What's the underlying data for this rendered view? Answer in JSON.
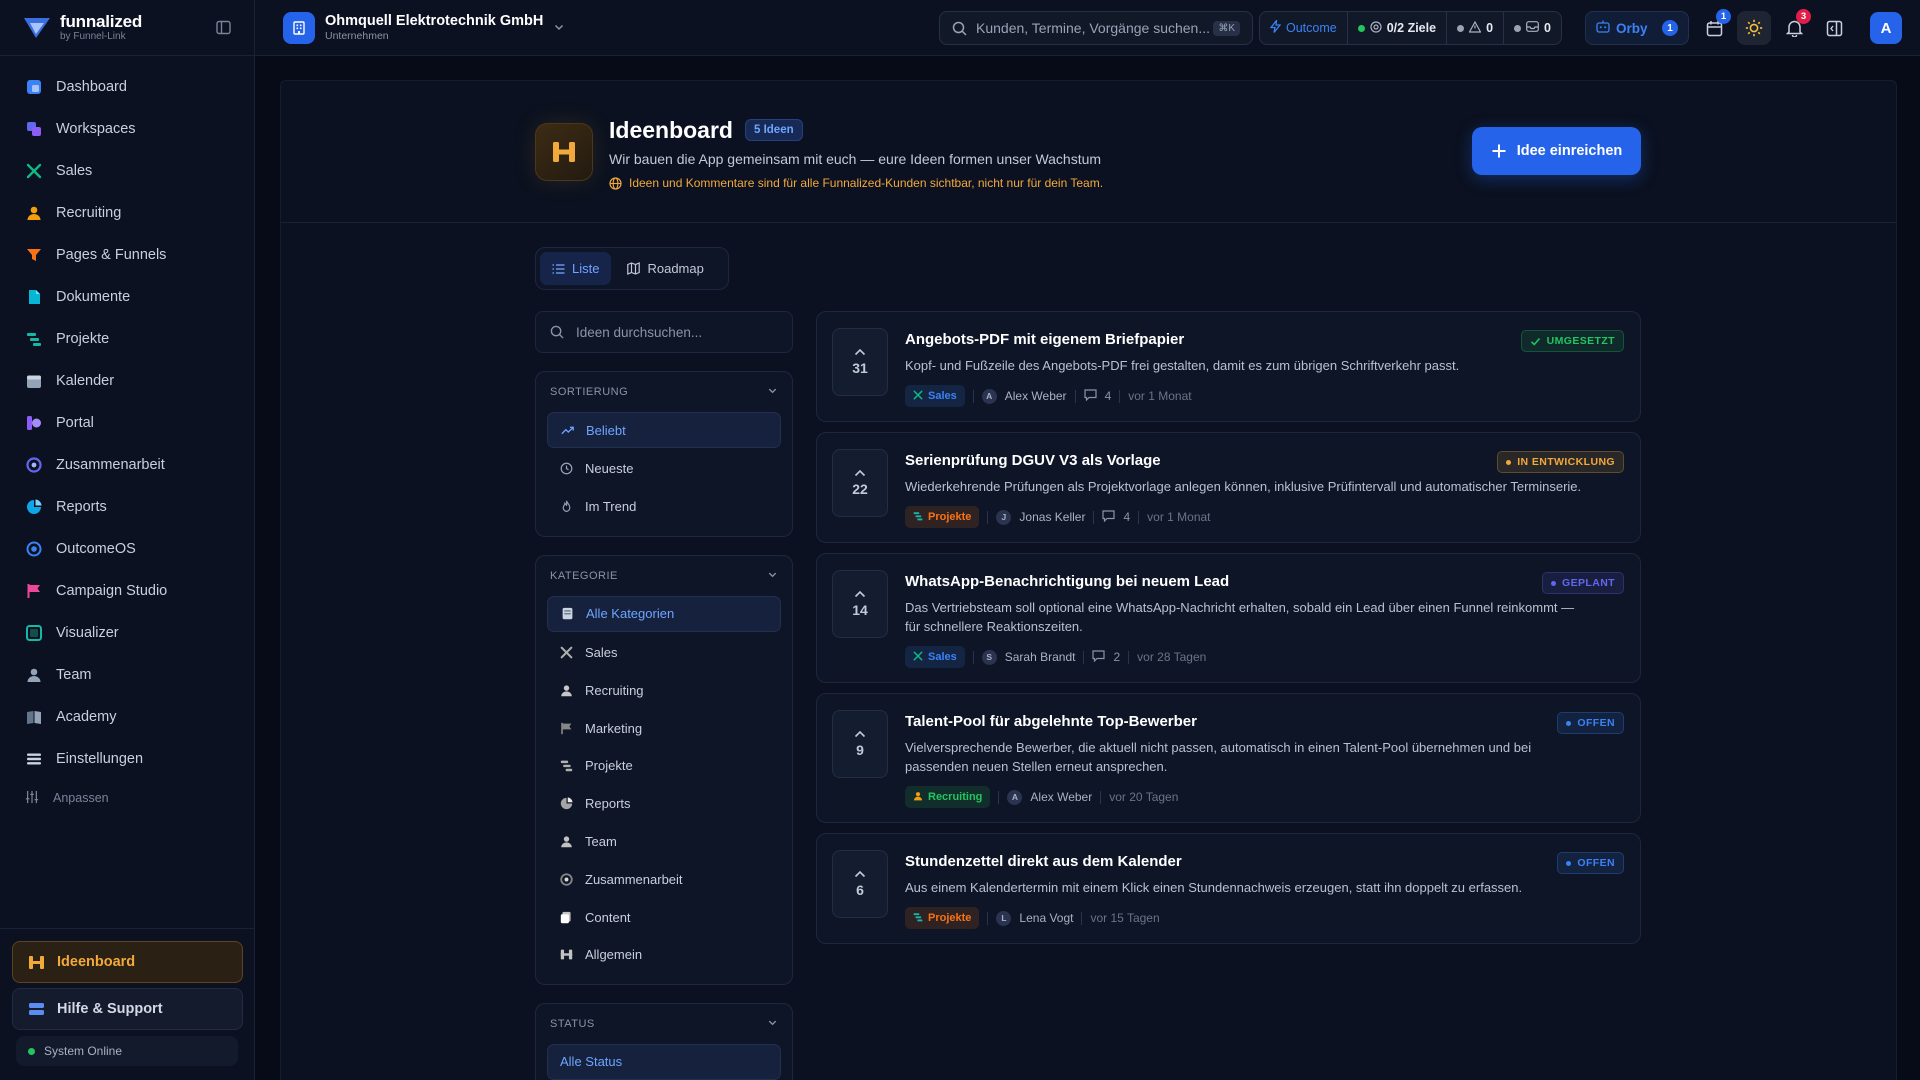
{
  "brand": {
    "name": "funnalized",
    "sub": "by Funnel-Link"
  },
  "colors": {
    "accent": "#2563eb",
    "warning": "#f2a93b",
    "success": "#22c55e",
    "bg": "#070b18"
  },
  "sidebar": {
    "items": [
      {
        "label": "Dashboard",
        "icon": "dashboard-icon"
      },
      {
        "label": "Workspaces",
        "icon": "workspaces-icon"
      },
      {
        "label": "Sales",
        "icon": "sales-icon"
      },
      {
        "label": "Recruiting",
        "icon": "recruiting-icon"
      },
      {
        "label": "Pages & Funnels",
        "icon": "funnel-icon"
      },
      {
        "label": "Dokumente",
        "icon": "document-icon"
      },
      {
        "label": "Projekte",
        "icon": "projects-icon"
      },
      {
        "label": "Kalender",
        "icon": "calendar-icon"
      },
      {
        "label": "Portal",
        "icon": "portal-icon"
      },
      {
        "label": "Zusammenarbeit",
        "icon": "collaboration-icon"
      },
      {
        "label": "Reports",
        "icon": "reports-icon"
      },
      {
        "label": "OutcomeOS",
        "icon": "outcome-icon"
      },
      {
        "label": "Campaign Studio",
        "icon": "flag-icon"
      },
      {
        "label": "Visualizer",
        "icon": "visualizer-icon"
      },
      {
        "label": "Team",
        "icon": "team-icon"
      },
      {
        "label": "Academy",
        "icon": "academy-icon"
      },
      {
        "label": "Einstellungen",
        "icon": "settings-icon"
      }
    ],
    "customize_label": "Anpassen",
    "ideenboard_label": "Ideenboard",
    "help_label": "Hilfe & Support",
    "system_status": "System Online"
  },
  "topbar": {
    "company_name": "Ohmquell Elektrotechnik GmbH",
    "company_sub": "Unternehmen",
    "search_placeholder": "Kunden, Termine, Vorgänge suchen...",
    "search_shortcut": "⌘K",
    "outcome_label": "Outcome",
    "goals_label": "0/2 Ziele",
    "warnings_count": "0",
    "messages_count": "0",
    "orby_label": "Orby",
    "orby_count": "1",
    "calendar_badge": "1",
    "notifications_badge": "3",
    "avatar_initial": "A"
  },
  "hero": {
    "title": "Ideenboard",
    "count_badge": "5 Ideen",
    "subtitle": "Wir bauen die App gemeinsam mit euch — eure Ideen formen unser Wachstum",
    "note": "Ideen und Kommentare sind für alle Funnalized-Kunden sichtbar, nicht nur für dein Team.",
    "submit_label": "Idee einreichen"
  },
  "view_toggle": {
    "list_label": "Liste",
    "roadmap_label": "Roadmap"
  },
  "filters": {
    "search_placeholder": "Ideen durchsuchen...",
    "sort": {
      "heading": "SORTIERUNG",
      "options": [
        {
          "label": "Beliebt",
          "icon": "trending-icon"
        },
        {
          "label": "Neueste",
          "icon": "clock-icon"
        },
        {
          "label": "Im Trend",
          "icon": "flame-icon"
        }
      ]
    },
    "category": {
      "heading": "KATEGORIE",
      "options": [
        {
          "label": "Alle Kategorien",
          "icon": "all-categories-icon"
        },
        {
          "label": "Sales",
          "icon": "sales-icon"
        },
        {
          "label": "Recruiting",
          "icon": "recruiting-icon"
        },
        {
          "label": "Marketing",
          "icon": "flag-icon"
        },
        {
          "label": "Projekte",
          "icon": "projects-icon"
        },
        {
          "label": "Reports",
          "icon": "reports-icon"
        },
        {
          "label": "Team",
          "icon": "team-icon"
        },
        {
          "label": "Zusammenarbeit",
          "icon": "collaboration-icon"
        },
        {
          "label": "Content",
          "icon": "content-icon"
        },
        {
          "label": "Allgemein",
          "icon": "general-icon"
        }
      ]
    },
    "status": {
      "heading": "STATUS",
      "options": [
        {
          "label": "Alle Status"
        }
      ]
    }
  },
  "ideas": [
    {
      "votes": "31",
      "title": "Angebots-PDF mit eigenem Briefpapier",
      "description": "Kopf- und Fußzeile des Angebots-PDF frei gestalten, damit es zum übrigen Schriftverkehr passt.",
      "category": "Sales",
      "category_color": "#3b82f6",
      "author_initial": "A",
      "author": "Alex Weber",
      "comments": "4",
      "time": "vor 1 Monat",
      "status": "UMGESETZT",
      "status_color": "#22c55e"
    },
    {
      "votes": "22",
      "title": "Serienprüfung DGUV V3 als Vorlage",
      "description": "Wiederkehrende Prüfungen als Projektvorlage anlegen können, inklusive Prüfintervall und automatischer Terminserie.",
      "category": "Projekte",
      "category_color": "#f97316",
      "author_initial": "J",
      "author": "Jonas Keller",
      "comments": "4",
      "time": "vor 1 Monat",
      "status": "IN ENTWICKLUNG",
      "status_color": "#f2a93b"
    },
    {
      "votes": "14",
      "title": "WhatsApp-Benachrichtigung bei neuem Lead",
      "description": "Das Vertriebsteam soll optional eine WhatsApp-Nachricht erhalten, sobald ein Lead über einen Funnel reinkommt — für schnellere Reaktionszeiten.",
      "category": "Sales",
      "category_color": "#3b82f6",
      "author_initial": "S",
      "author": "Sarah Brandt",
      "comments": "2",
      "time": "vor 28 Tagen",
      "status": "GEPLANT",
      "status_color": "#6366f1"
    },
    {
      "votes": "9",
      "title": "Talent-Pool für abgelehnte Top-Bewerber",
      "description": "Vielversprechende Bewerber, die aktuell nicht passen, automatisch in einen Talent-Pool übernehmen und bei passenden neuen Stellen erneut ansprechen.",
      "category": "Recruiting",
      "category_color": "#22c55e",
      "author_initial": "A",
      "author": "Alex Weber",
      "comments": "",
      "time": "vor 20 Tagen",
      "status": "OFFEN",
      "status_color": "#3b82f6"
    },
    {
      "votes": "6",
      "title": "Stundenzettel direkt aus dem Kalender",
      "description": "Aus einem Kalendertermin mit einem Klick einen Stundennachweis erzeugen, statt ihn doppelt zu erfassen.",
      "category": "Projekte",
      "category_color": "#f97316",
      "author_initial": "L",
      "author": "Lena Vogt",
      "comments": "",
      "time": "vor 15 Tagen",
      "status": "OFFEN",
      "status_color": "#3b82f6"
    }
  ]
}
